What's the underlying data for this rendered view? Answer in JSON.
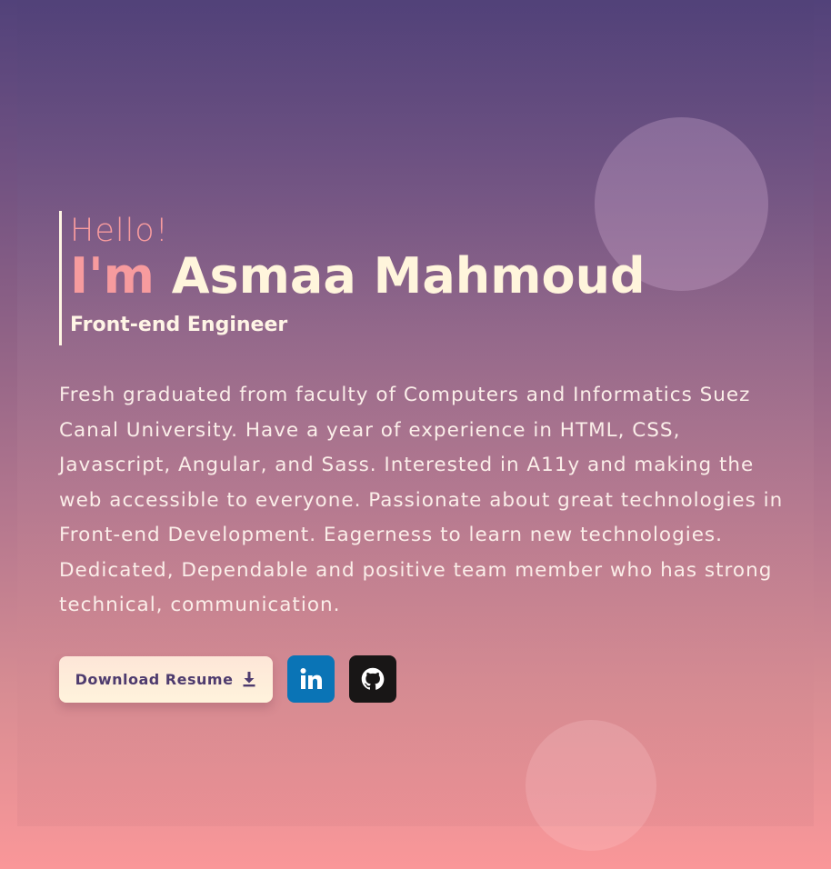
{
  "hero": {
    "greeting": "Hello!",
    "im": "I'm",
    "name": "Asmaa Mahmoud",
    "role": "Front-end Engineer"
  },
  "bio": "Fresh graduated from faculty of Computers and Informatics Suez Canal University. Have a year of experience in HTML, CSS, Javascript, Angular, and Sass. Interested in A11y and making the web accessible to everyone. Passionate about great technologies in Front-end Development. Eagerness to learn new technologies. Dedicated, Dependable and positive team member who has strong technical, communication.",
  "actions": {
    "resume_label": "Download Resume",
    "resume_icon": "download-icon",
    "linkedin_icon": "linkedin-icon",
    "github_icon": "github-icon"
  },
  "colors": {
    "accent_pink": "#f79b9e",
    "name_cream": "#fff5dc",
    "linkedin_blue": "#0a74b6",
    "github_black": "#181616",
    "button_text": "#4e3b6e"
  }
}
